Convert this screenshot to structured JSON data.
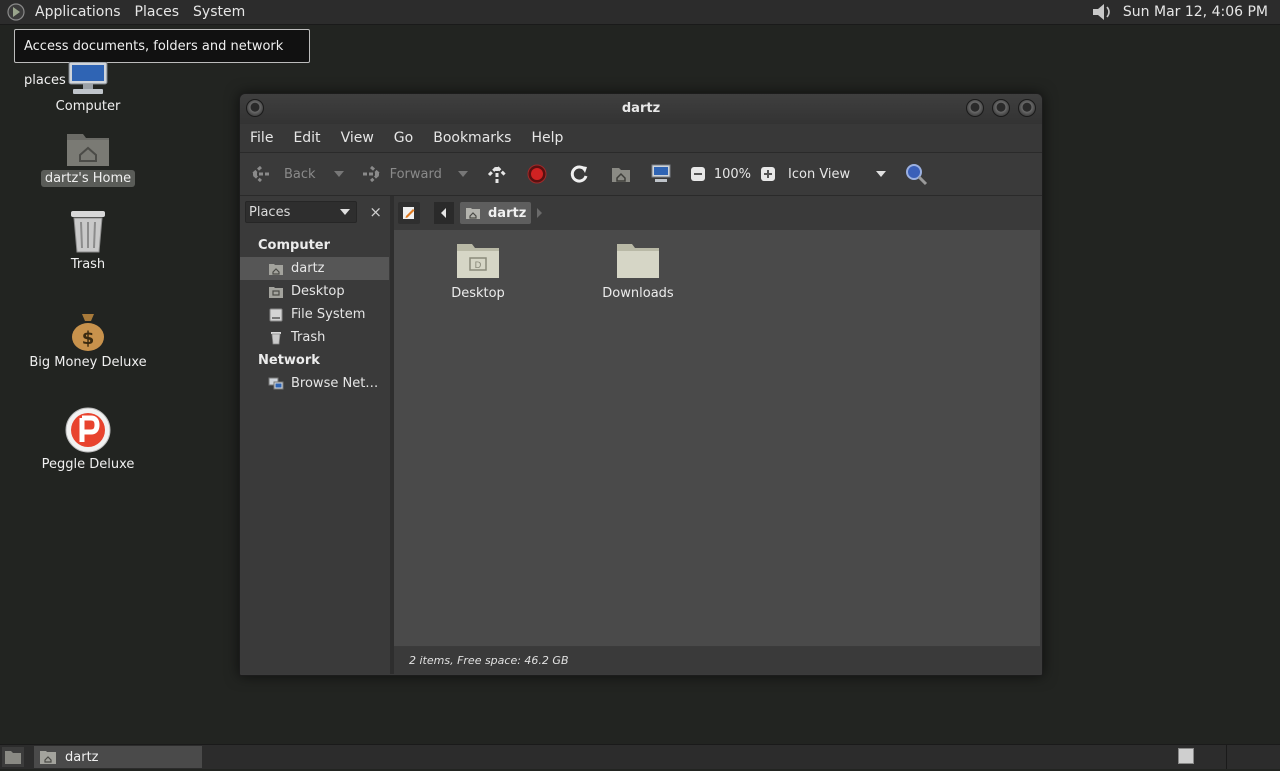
{
  "top_panel": {
    "menus": [
      "Applications",
      "Places",
      "System"
    ],
    "clock": "Sun Mar 12,  4:06 PM",
    "icons": [
      "gnome-foot-icon",
      "volume-icon"
    ]
  },
  "tooltip": "Access documents, folders and network places",
  "desktop": {
    "icons": [
      {
        "label": "Computer",
        "icon": "computer-icon"
      },
      {
        "label": "dartz's Home",
        "icon": "home-folder-icon"
      },
      {
        "label": "Trash",
        "icon": "trash-icon"
      },
      {
        "label": "Big Money Deluxe",
        "icon": "money-bag-icon"
      },
      {
        "label": "Peggle Deluxe",
        "icon": "peggle-icon"
      }
    ]
  },
  "window": {
    "title": "dartz",
    "menubar": [
      "File",
      "Edit",
      "View",
      "Go",
      "Bookmarks",
      "Help"
    ],
    "toolbar": {
      "back": "Back",
      "forward": "Forward",
      "zoom": "100%",
      "view_mode": "Icon View"
    },
    "sidebar": {
      "selector": "Places",
      "close": "×",
      "sections": [
        {
          "title": "Computer",
          "items": [
            {
              "label": "dartz",
              "icon": "home-icon"
            },
            {
              "label": "Desktop",
              "icon": "desktop-icon"
            },
            {
              "label": "File System",
              "icon": "drive-icon"
            },
            {
              "label": "Trash",
              "icon": "trash-icon"
            }
          ]
        },
        {
          "title": "Network",
          "items": [
            {
              "label": "Browse Net…",
              "icon": "network-icon"
            }
          ]
        }
      ]
    },
    "pathbar": {
      "current": "dartz"
    },
    "files": [
      {
        "label": "Desktop",
        "icon": "desktop-folder-icon"
      },
      {
        "label": "Downloads",
        "icon": "folder-icon"
      }
    ],
    "status": "2 items, Free space: 46.2 GB"
  },
  "taskbar": {
    "window_button": "dartz"
  },
  "colors": {
    "desktop_bg": "#222421",
    "panel_bg": "#2c2c2c",
    "content_bg": "#4a4a4a",
    "selection_bg": "#565656"
  }
}
